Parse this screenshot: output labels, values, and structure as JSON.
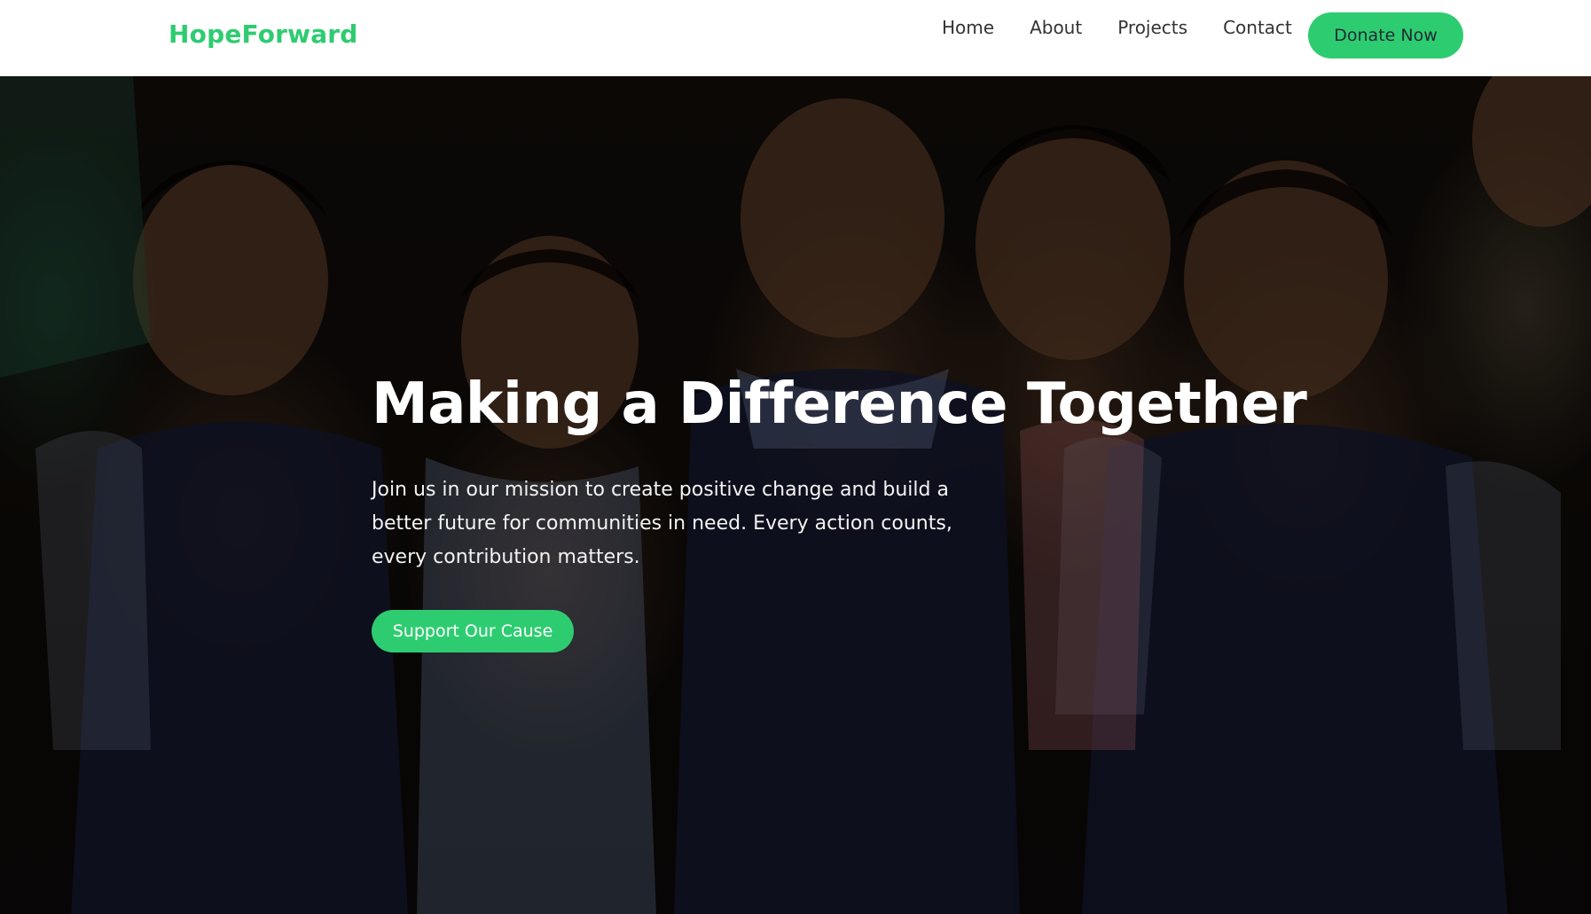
{
  "header": {
    "brand": "HopeForward",
    "nav": [
      "Home",
      "About",
      "Projects",
      "Contact"
    ],
    "donate_label": "Donate Now"
  },
  "hero": {
    "title": "Making a Difference Together",
    "subtitle": "Join us in our mission to create positive change and build a better future for communities in need. Every action counts, every contribution matters.",
    "cta_label": "Support Our Cause",
    "image_alt": "Smiling schoolchildren in blue uniforms"
  },
  "colors": {
    "accent": "#2ecc71",
    "nav_text": "#333333",
    "navbar_bg": "#ffffff"
  }
}
